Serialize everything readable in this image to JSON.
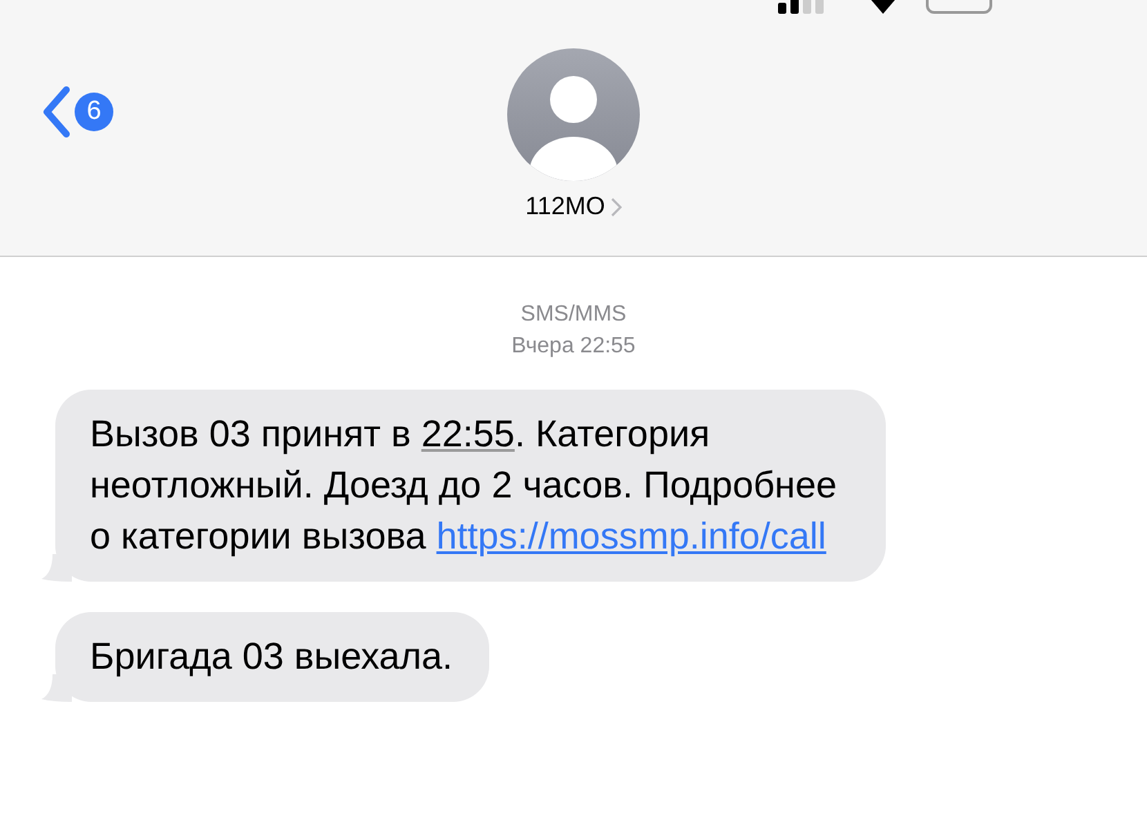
{
  "header": {
    "unread_count": "6",
    "contact_name": "112MO"
  },
  "thread": {
    "service": "SMS/MMS",
    "timestamp": "Вчера 22:55"
  },
  "messages": [
    {
      "parts": [
        {
          "kind": "text",
          "text": "Вызов 03 принят в "
        },
        {
          "kind": "time",
          "text": "22:55"
        },
        {
          "kind": "text",
          "text": ". Категория неотложный. Доезд до 2 часов. Подробнее о категории вызова "
        },
        {
          "kind": "link",
          "text": "https://mossmp.info/call"
        }
      ]
    },
    {
      "parts": [
        {
          "kind": "text",
          "text": "Бригада 03 выехала."
        }
      ]
    }
  ]
}
